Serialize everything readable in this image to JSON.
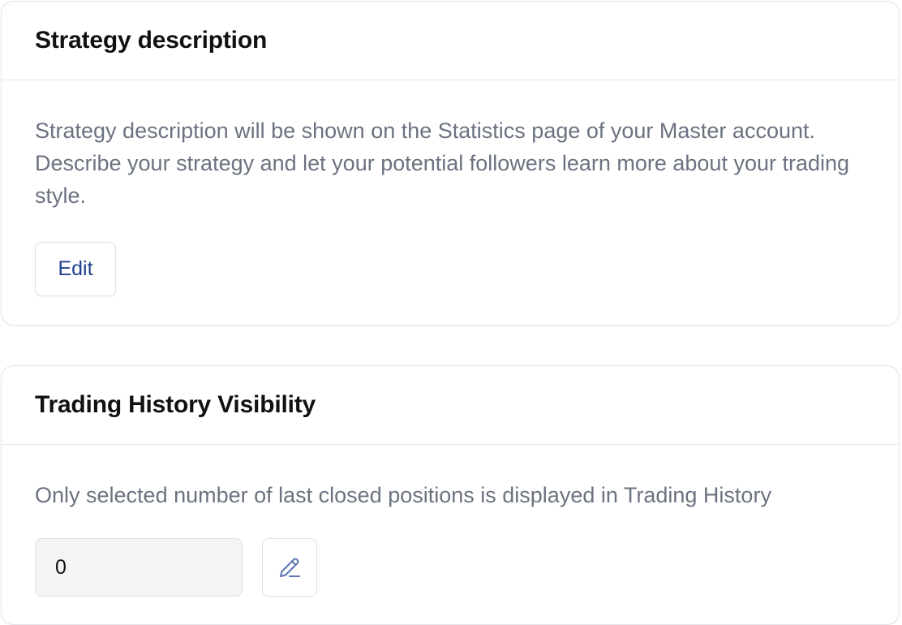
{
  "strategy": {
    "title": "Strategy description",
    "description": "Strategy description will be shown on the Statistics page of your Master account. Describe your strategy and let your potential followers learn more about your trading style.",
    "edit_label": "Edit"
  },
  "history": {
    "title": "Trading History Visibility",
    "description": "Only selected number of last closed positions is displayed in Trading History",
    "count_value": "0",
    "edit_icon": "pencil-icon"
  },
  "colors": {
    "link": "#1f3f8f",
    "muted_text": "#6b7280",
    "border": "#e3e5e8",
    "icon": "#5b73b5"
  }
}
